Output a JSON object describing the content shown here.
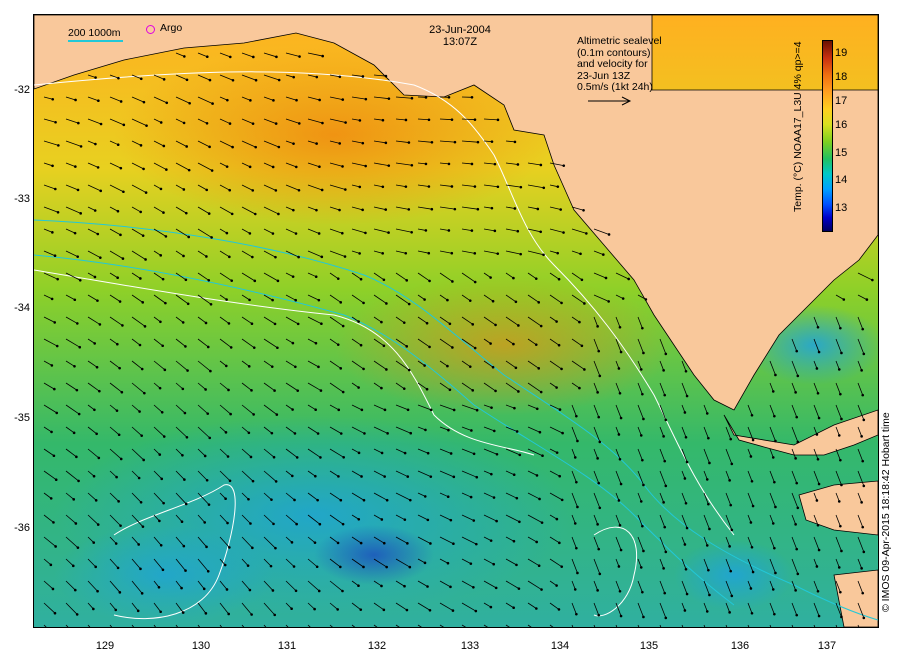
{
  "map": {
    "date": "23-Jun-2004",
    "time": "13:07Z",
    "sealevel_note": [
      "Altimetric sealevel",
      "(0.1m contours)",
      "and velocity for",
      "23-Jun 13Z",
      "0.5m/s (1kt 24h)"
    ],
    "contour_legend": "200  1000m",
    "argo_label": "Argo",
    "colorbar_title": "Temp. (°C) NOAA17_L3U 4% qp>=4",
    "credit": "© IMOS 09-Apr-2015 18:18:42 Hobart time",
    "colorbar_ticks": [
      "13",
      "14",
      "15",
      "16",
      "17",
      "18",
      "19"
    ],
    "lat_ticks": [
      "-32",
      "-33",
      "-34",
      "-35",
      "-36"
    ],
    "lon_ticks": [
      "129",
      "130",
      "131",
      "132",
      "133",
      "134",
      "135",
      "136",
      "137"
    ],
    "colors": {
      "land": "#f9c89b",
      "contour": "#22c8d8",
      "sealevel": "#ffffff",
      "arrow": "#000000"
    }
  }
}
